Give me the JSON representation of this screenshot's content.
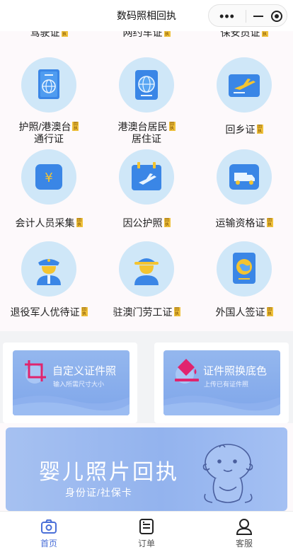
{
  "nav": {
    "title": "数码照相回执",
    "more_icon": "•••"
  },
  "badge_text": "回执",
  "grid": {
    "top_row": [
      {
        "label": "驾驶证"
      },
      {
        "label": "网约车证"
      },
      {
        "label": "保安员证"
      }
    ],
    "items": [
      {
        "label": "护照/港澳台",
        "label2": "通行证",
        "icon": "passport-icon"
      },
      {
        "label": "港澳台居民",
        "label2": "居住证",
        "icon": "globe-book-icon"
      },
      {
        "label": "回乡证",
        "label2": "",
        "icon": "plane-ticket-icon"
      },
      {
        "label": "会计人员采集",
        "label2": "",
        "icon": "yuan-icon"
      },
      {
        "label": "因公护照",
        "label2": "",
        "icon": "calendar-plane-icon"
      },
      {
        "label": "运输资格证",
        "label2": "",
        "icon": "truck-icon"
      },
      {
        "label": "退役军人优待证",
        "label2": "",
        "icon": "soldier-icon"
      },
      {
        "label": "驻澳门劳工证",
        "label2": "",
        "icon": "worker-icon"
      },
      {
        "label": "外国人签证",
        "label2": "",
        "icon": "visa-book-icon"
      }
    ]
  },
  "cards": [
    {
      "title": "自定义证件照",
      "subtitle": "输入所需尺寸大小",
      "icon": "crop-icon"
    },
    {
      "title": "证件照换底色",
      "subtitle": "上传已有证件照",
      "icon": "paint-bucket-icon"
    }
  ],
  "banner": {
    "title": "婴儿照片回执",
    "subtitle": "身份证/社保卡"
  },
  "tabbar": [
    {
      "label": "首页",
      "icon": "camera-icon",
      "active": true
    },
    {
      "label": "订单",
      "icon": "order-list-icon",
      "active": false
    },
    {
      "label": "客服",
      "icon": "service-person-icon",
      "active": false
    }
  ],
  "colors": {
    "accent": "#4a6fd8",
    "icon_bg": "#cfe7f8",
    "badge": "#f0c23b"
  }
}
